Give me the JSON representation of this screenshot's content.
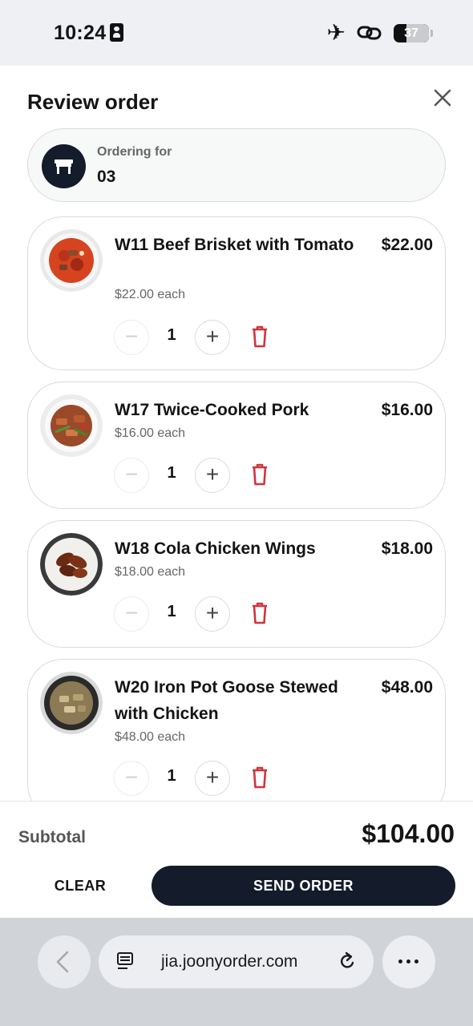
{
  "status_bar": {
    "time": "10:24",
    "battery": "37"
  },
  "header": {
    "title": "Review order"
  },
  "ordering_for": {
    "label": "Ordering for",
    "value": "03"
  },
  "items": [
    {
      "name": "W11 Beef Brisket with Tomato",
      "price": "$22.00",
      "each": "$22.00 each",
      "qty": "1"
    },
    {
      "name": "W17 Twice-Cooked Pork",
      "price": "$16.00",
      "each": "$16.00 each",
      "qty": "1"
    },
    {
      "name": "W18 Cola Chicken Wings",
      "price": "$18.00",
      "each": "$18.00 each",
      "qty": "1"
    },
    {
      "name": "W20 Iron Pot Goose Stewed with Chicken",
      "price": "$48.00",
      "each": "$48.00 each",
      "qty": "1"
    }
  ],
  "footer": {
    "subtotal_label": "Subtotal",
    "subtotal_value": "$104.00",
    "clear_label": "CLEAR",
    "send_label": "SEND ORDER"
  },
  "browser": {
    "url": "jia.joonyorder.com"
  },
  "colors": {
    "primary_dark": "#141b2b",
    "delete_red": "#d0343a"
  }
}
